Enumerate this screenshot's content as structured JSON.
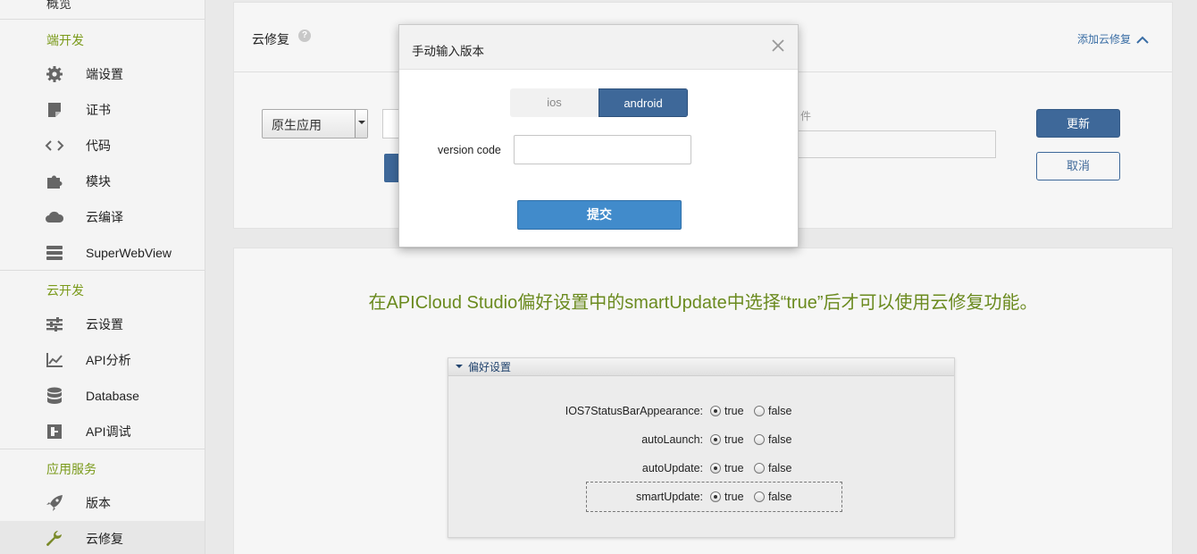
{
  "sidebar": {
    "top_item": "概览",
    "sections": [
      {
        "title": "端开发",
        "items": [
          {
            "label": "端设置",
            "icon": "gear-icon"
          },
          {
            "label": "证书",
            "icon": "certificate-icon"
          },
          {
            "label": "代码",
            "icon": "code-icon"
          },
          {
            "label": "模块",
            "icon": "puzzle-icon"
          },
          {
            "label": "云编译",
            "icon": "cloud-icon"
          },
          {
            "label": "SuperWebView",
            "icon": "layers-icon"
          }
        ]
      },
      {
        "title": "云开发",
        "items": [
          {
            "label": "云设置",
            "icon": "sliders-icon"
          },
          {
            "label": "API分析",
            "icon": "chart-icon"
          },
          {
            "label": "Database",
            "icon": "database-icon"
          },
          {
            "label": "API调试",
            "icon": "debug-icon"
          }
        ]
      },
      {
        "title": "应用服务",
        "items": [
          {
            "label": "版本",
            "icon": "rocket-icon"
          },
          {
            "label": "云修复",
            "icon": "wrench-icon"
          }
        ]
      }
    ]
  },
  "cloudfix": {
    "title": "云修复",
    "help": "?",
    "add_link": "添加云修复",
    "select_value": "原生应用",
    "field_label_fragment": "件",
    "update_button": "更新",
    "cancel_button": "取消"
  },
  "notice": "在APICloud Studio偏好设置中的smartUpdate中选择“true”后才可以使用云修复功能。",
  "preferences": {
    "title": "偏好设置",
    "rows": [
      {
        "key": "IOS7StatusBarAppearance:",
        "true_label": "true",
        "false_label": "false",
        "value": true
      },
      {
        "key": "autoLaunch:",
        "true_label": "true",
        "false_label": "false",
        "value": true
      },
      {
        "key": "autoUpdate:",
        "true_label": "true",
        "false_label": "false",
        "value": true
      },
      {
        "key": "smartUpdate:",
        "true_label": "true",
        "false_label": "false",
        "value": true
      }
    ]
  },
  "modal": {
    "title": "手动输入版本",
    "platforms": [
      "ios",
      "android"
    ],
    "selected_platform": "android",
    "version_code_label": "version code",
    "version_code_value": "",
    "submit_label": "提交"
  },
  "colors": {
    "accent_blue": "#3e6899",
    "submit_blue": "#418bcb",
    "section_green": "#7a9a1a",
    "notice_green": "#6a8a1e"
  }
}
